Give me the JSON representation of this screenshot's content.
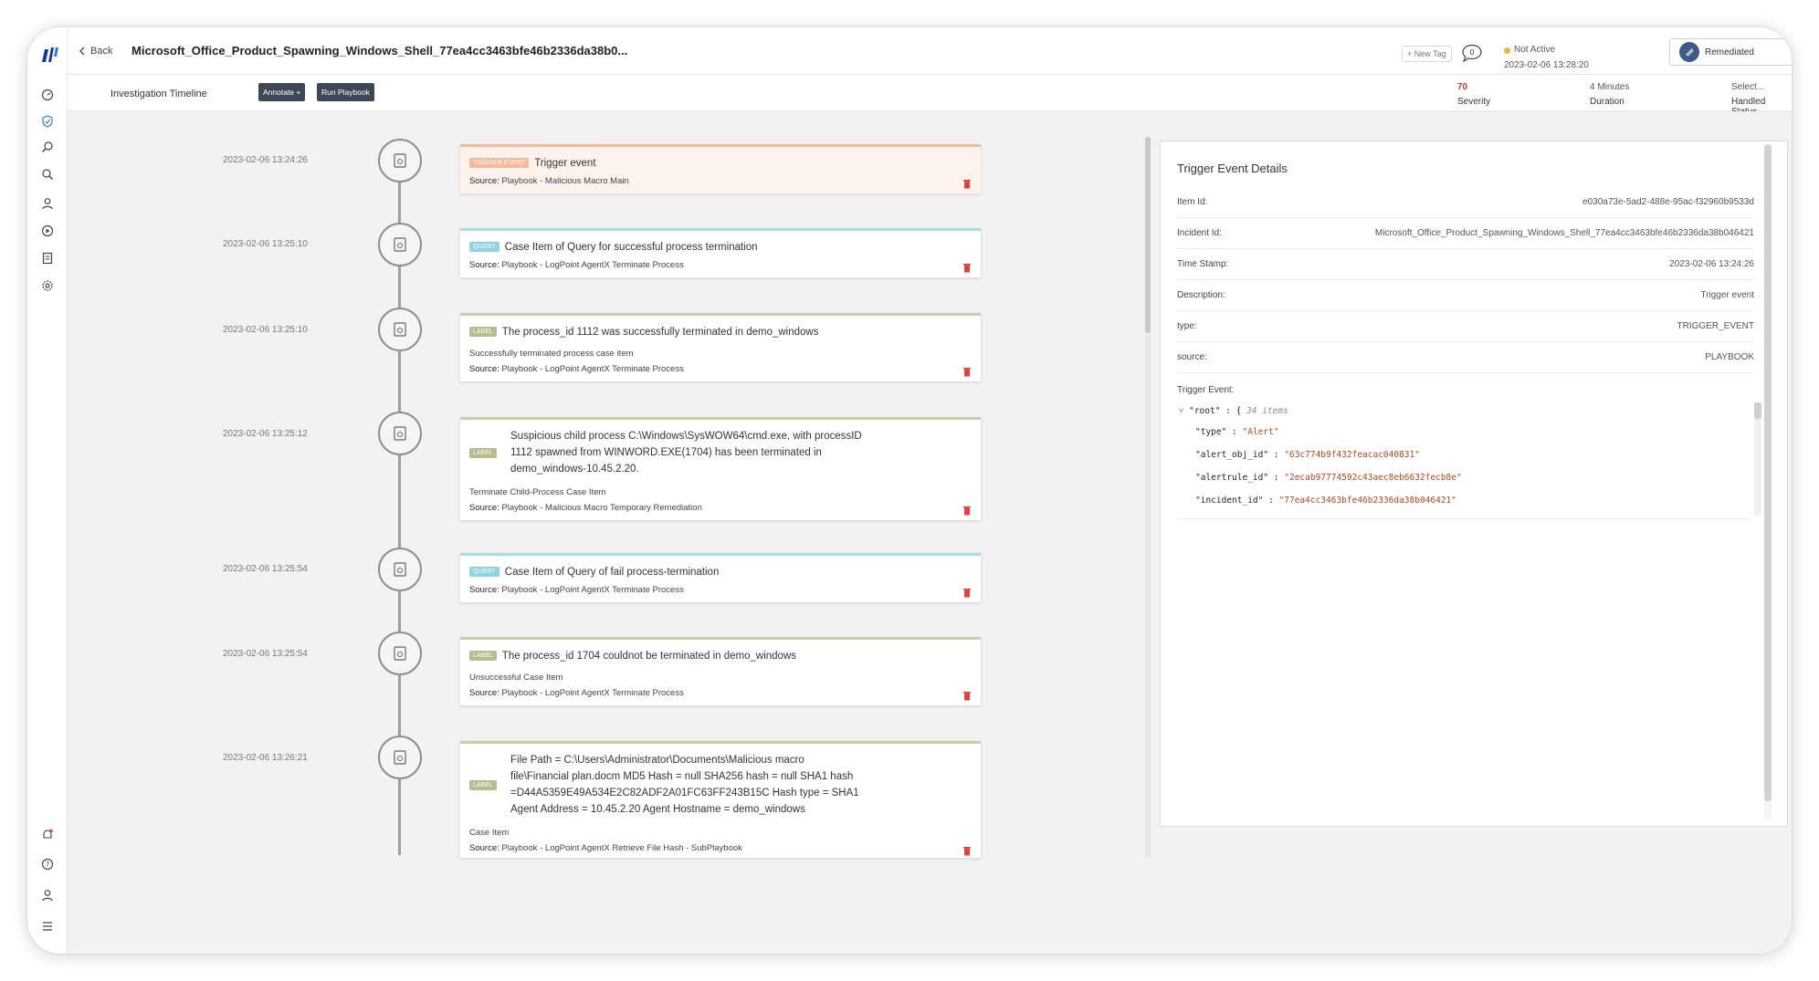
{
  "header": {
    "back_label": "Back",
    "title": "Microsoft_Office_Product_Spawning_Windows_Shell_77ea4cc3463bfe46b2336da38b0...",
    "new_tag_label": "+ New Tag",
    "comment_count": "0",
    "status_label": "Not Active",
    "status_time": "2023-02-06 13:28:20",
    "status_color": "#f2b330",
    "remediation_status": "Remediated"
  },
  "subheader": {
    "tab_label": "Investigation Timeline",
    "annotate_label": "Annotate +",
    "run_playbook_label": "Run Playbook",
    "severity_value": "70",
    "severity_label": "Severity",
    "duration_value": "4 Minutes",
    "duration_label": "Duration",
    "handled_value": "Select...",
    "handled_label": "Handled Status"
  },
  "sidebar": {
    "icons": [
      "dashboard-icon",
      "shield-icon",
      "hunt-icon",
      "search-icon",
      "user-icon",
      "play-icon",
      "report-icon",
      "settings-icon"
    ],
    "bottom_icons": [
      "notification-bell-icon",
      "help-icon",
      "profile-icon",
      "menu-icon"
    ]
  },
  "timeline": [
    {
      "timestamp": "2023-02-06 13:24:26",
      "badge": "TRIGGER EVENT",
      "type": "trigger",
      "title": "Trigger event",
      "sub": "",
      "source_label": "Source:",
      "source": "Playbook - Malicious Macro Main"
    },
    {
      "timestamp": "2023-02-06 13:25:10",
      "badge": "QUERY",
      "type": "query",
      "title": "Case Item of Query for successful process termination",
      "sub": "",
      "source_label": "Source:",
      "source": "Playbook - LogPoint AgentX Terminate Process"
    },
    {
      "timestamp": "2023-02-06 13:25:10",
      "badge": "LABEL",
      "type": "label",
      "title": "The process_id 1112 was successfully terminated in demo_windows",
      "sub": "Successfully terminated process case item",
      "source_label": "Source:",
      "source": "Playbook - LogPoint AgentX Terminate Process"
    },
    {
      "timestamp": "2023-02-06 13:25:12",
      "badge": "LABEL",
      "type": "label",
      "title_lines": [
        "Suspicious child process C:\\Windows\\SysWOW64\\cmd.exe, with processID",
        "1112 spawned from WINWORD.EXE(1704) has been terminated in",
        "demo_windows-10.45.2.20."
      ],
      "sub": "Terminate Child-Process Case Item",
      "source_label": "Source:",
      "source": "Playbook - Malicious Macro Temporary Remediation"
    },
    {
      "timestamp": "2023-02-06 13:25:54",
      "badge": "QUERY",
      "type": "query",
      "title": "Case Item of Query of fail process-termination",
      "sub": "",
      "source_label": "Source:",
      "source": "Playbook - LogPoint AgentX Terminate Process"
    },
    {
      "timestamp": "2023-02-06 13:25:54",
      "badge": "LABEL",
      "type": "label",
      "title": "The process_id 1704 couldnot be terminated in demo_windows",
      "sub": "Unsuccessful Case Item",
      "source_label": "Source:",
      "source": "Playbook - LogPoint AgentX Terminate Process"
    },
    {
      "timestamp": "2023-02-06 13:26:21",
      "badge": "LABEL",
      "type": "label",
      "title_lines": [
        "File Path = C:\\Users\\Administrator\\Documents\\Malicious macro",
        "file\\Financial plan.docm MD5 Hash = null SHA256 hash = null SHA1 hash",
        "=D44A5359E49A534E2C82ADF2A01FC63FF243B15C Hash type = SHA1",
        "Agent Address = 10.45.2.20 Agent Hostname = demo_windows"
      ],
      "sub": "Case Item",
      "source_label": "Source:",
      "source": "Playbook - LogPoint AgentX Retrieve File Hash - SubPlaybook"
    }
  ],
  "details": {
    "title": "Trigger Event Details",
    "rows": [
      {
        "label": "Item Id:",
        "value": "e030a73e-5ad2-488e-95ac-f32960b9533d"
      },
      {
        "label": "Incident Id:",
        "value": "Microsoft_Office_Product_Spawning_Windows_Shell_77ea4cc3463bfe46b2336da38b046421"
      },
      {
        "label": "Time Stamp:",
        "value": "2023-02-06 13:24:26"
      },
      {
        "label": "Description:",
        "value": "Trigger event"
      },
      {
        "label": "type:",
        "value": "TRIGGER_EVENT"
      },
      {
        "label": "source:",
        "value": "PLAYBOOK"
      }
    ],
    "trigger_event_label": "Trigger Event:",
    "json": {
      "root_key": "\"root\"",
      "root_meta": "34 items",
      "entries": [
        {
          "key": "\"type\"",
          "value": "\"Alert\""
        },
        {
          "key": "\"alert_obj_id\"",
          "value": "\"63c774b9f432feacac040831\""
        },
        {
          "key": "\"alertrule_id\"",
          "value": "\"2ecab97774592c43aec8eb6632fecb8e\""
        },
        {
          "key": "\"incident_id\"",
          "value": "\"77ea4cc3463bfe46b2336da38b046421\""
        }
      ]
    }
  }
}
